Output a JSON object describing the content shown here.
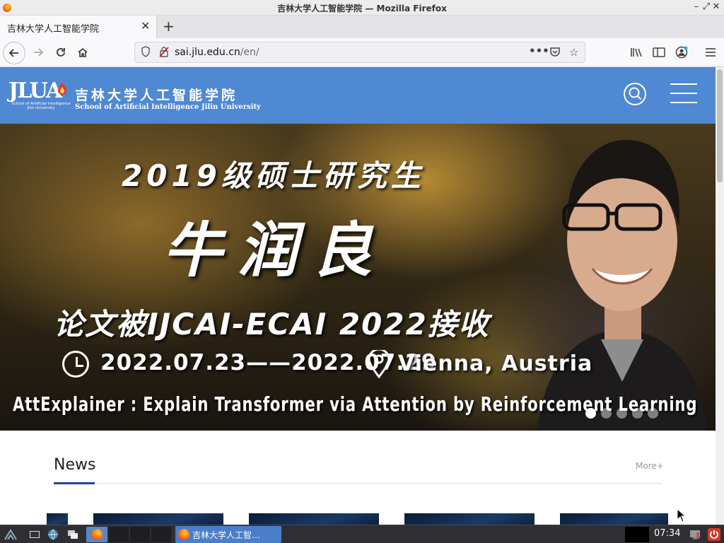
{
  "window": {
    "title": "吉林大学人工智能学院 — Mozilla Firefox"
  },
  "tabs": [
    {
      "label": "吉林大学人工智能学院",
      "active": true
    }
  ],
  "navbar": {
    "url_domain": "sai.jlu.edu.cn",
    "url_path": "/en/"
  },
  "site": {
    "logo_letters": "JLUA",
    "logo_subtitle": "School of Artificial Intelligence Jilin University",
    "name_cn": "吉林大学人工智能学院",
    "name_en": "School of Artificial Intelligence Jilin University"
  },
  "banner": {
    "title_line": "2019级硕士研究生",
    "name": "牛润良",
    "accepted_line": "论文被IJCAI-ECAI 2022接收",
    "dates": "2022.07.23——2022.07.29",
    "location": "Vienna, Austria",
    "paper_title": "AttExplainer : Explain Transformer via Attention by Reinforcement Learning",
    "slides": 5,
    "active_slide": 1
  },
  "news": {
    "heading": "News",
    "more_label": "More+"
  },
  "taskbar": {
    "active_task_label": "吉林大学人工智…",
    "clock": "07:34"
  },
  "colors": {
    "site_header": "#4f88d3",
    "news_accent": "#1d4a8c",
    "taskbar": "#2f2f33",
    "taskbar_active": "#4b7ec8"
  }
}
